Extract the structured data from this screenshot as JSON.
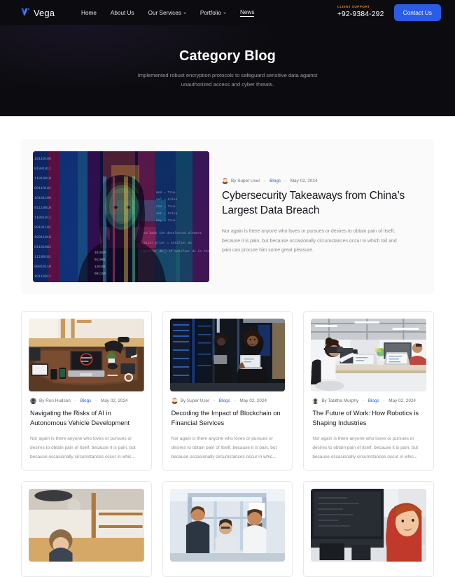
{
  "header": {
    "brand": {
      "name": "Vega",
      "logo_icon": "vega-v-logo-icon"
    },
    "nav": [
      {
        "label": "Home",
        "has_dropdown": false,
        "active": false
      },
      {
        "label": "About Us",
        "has_dropdown": false,
        "active": false
      },
      {
        "label": "Our Services",
        "has_dropdown": true,
        "active": false
      },
      {
        "label": "Portfolio",
        "has_dropdown": true,
        "active": false
      },
      {
        "label": "News",
        "has_dropdown": false,
        "active": true
      }
    ],
    "support_label": "CLIENT SUPPORT",
    "support_phone": "+92-9384-292",
    "contact_button": "Contact Us",
    "accent_color": "#2b5ce6",
    "support_label_color": "#d98a25",
    "background_color": "#0c0c10"
  },
  "hero": {
    "title": "Category Blog",
    "subtitle": "Implemented robust encryption protocols to safeguard sensitive data against unauthorized access and cyber threats."
  },
  "featured": {
    "image_alt": "woman silhouette overlaid with colorful binary code and data streams",
    "meta": {
      "avatar_icon": "author-avatar-icon",
      "author": "By Super User",
      "separator": "–",
      "category": "Blogs",
      "date": "May 02, 2024"
    },
    "title": "Cybersecurity Takeaways from China’s Largest Data Breach",
    "excerpt": "Nor again is there anyone who loves or pursues or desires to obtain pain of itself, because it is pain, but because occasionally circumstances occur in which toil and pain can procure him some great pleasure."
  },
  "posts": [
    {
      "image_alt": "overhead view of a wooden desk with laptop, tablet and phones",
      "avatar_icon": "author-avatar-icon",
      "author": "By Ron Hudson",
      "separator": "–",
      "category": "Blogs",
      "date": "May 02, 2024",
      "title": "Navigating the Risks of AI in Autonomous Vehicle Development",
      "excerpt": "Nor again is there anyone who loves or pursues or desires to obtain pain of itself, because it is pain, but because occasionally circumstances occur in whic..."
    },
    {
      "image_alt": "woman holding a laptop in a blue-lit server room",
      "avatar_icon": "author-avatar-icon",
      "author": "By Super User",
      "separator": "–",
      "category": "Blogs",
      "date": "May 02, 2024",
      "title": "Decoding the Impact of Blockchain on Financial Services",
      "excerpt": "Nor again is there anyone who loves or pursues or desires to obtain pain of itself, because it is pain, but because occasionally circumstances occur in whic..."
    },
    {
      "image_alt": "person wearing a VR headset at a desk in a bright open office",
      "avatar_icon": "author-avatar-icon",
      "author": "By Tabitha Murphy",
      "separator": "–",
      "category": "Blogs",
      "date": "May 02, 2024",
      "title": "The Future of Work: How Robotics is Shaping Industries",
      "excerpt": "Nor again is there anyone who loves or pursues or desires to obtain pain of itself, because it is pain, but because occasionally circumstances occur in whic..."
    }
  ],
  "posts_row2": [
    {
      "image_alt": "woman standing in a warmly lit interior space"
    },
    {
      "image_alt": "group of people working around equipment in a lab"
    },
    {
      "image_alt": "red-haired woman in front of large dark monitors"
    }
  ]
}
